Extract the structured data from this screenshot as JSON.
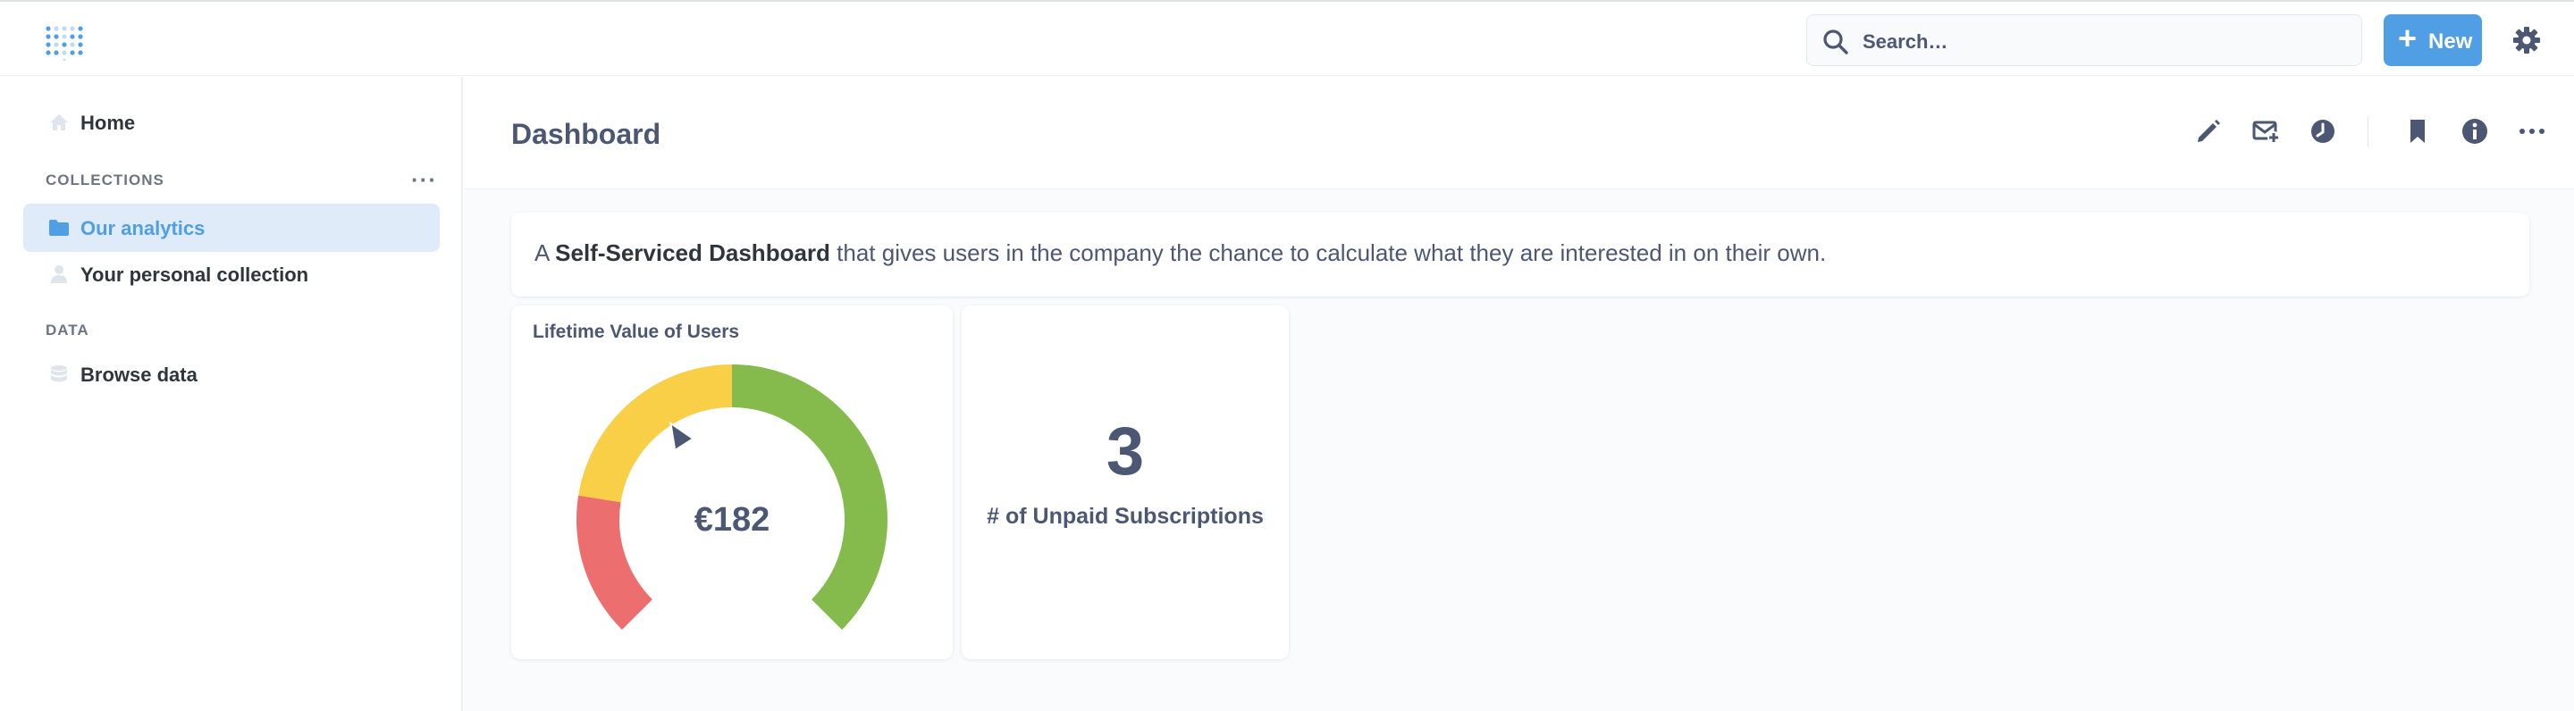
{
  "topbar": {
    "search_placeholder": "Search…",
    "new_label": "New",
    "plus_glyph": "+"
  },
  "sidebar": {
    "home_label": "Home",
    "collections_heading": "COLLECTIONS",
    "collections_menu": "···",
    "items": [
      {
        "label": "Our analytics",
        "icon": "folder-icon",
        "active": true
      },
      {
        "label": "Your personal collection",
        "icon": "person-icon",
        "active": false
      }
    ],
    "data_heading": "DATA",
    "browse_label": "Browse data"
  },
  "dashboard": {
    "title": "Dashboard",
    "header_icons": [
      "pencil-icon",
      "subscription-icon",
      "history-icon",
      "bookmark-icon",
      "info-icon",
      "more-icon"
    ],
    "text_card": {
      "prefix": "A ",
      "bold": "Self-Serviced Dashboard",
      "suffix": " that gives users in the company the chance to calculate what they are interested in on their own."
    },
    "gauge_card": {
      "title": "Lifetime Value of Users",
      "value_label": "€182",
      "value_fraction": 0.38,
      "segments": [
        {
          "color": "#ed6e6e",
          "from": 0.0,
          "to": 0.2
        },
        {
          "color": "#f9cf48",
          "from": 0.2,
          "to": 0.5
        },
        {
          "color": "#84bb4c",
          "from": 0.5,
          "to": 1.0
        }
      ]
    },
    "scalar_card": {
      "value": "3",
      "label": "# of Unpaid Subscriptions"
    }
  },
  "colors": {
    "brand": "#509ee3",
    "text": "#4c5773",
    "active_bg": "#dfebf8"
  }
}
